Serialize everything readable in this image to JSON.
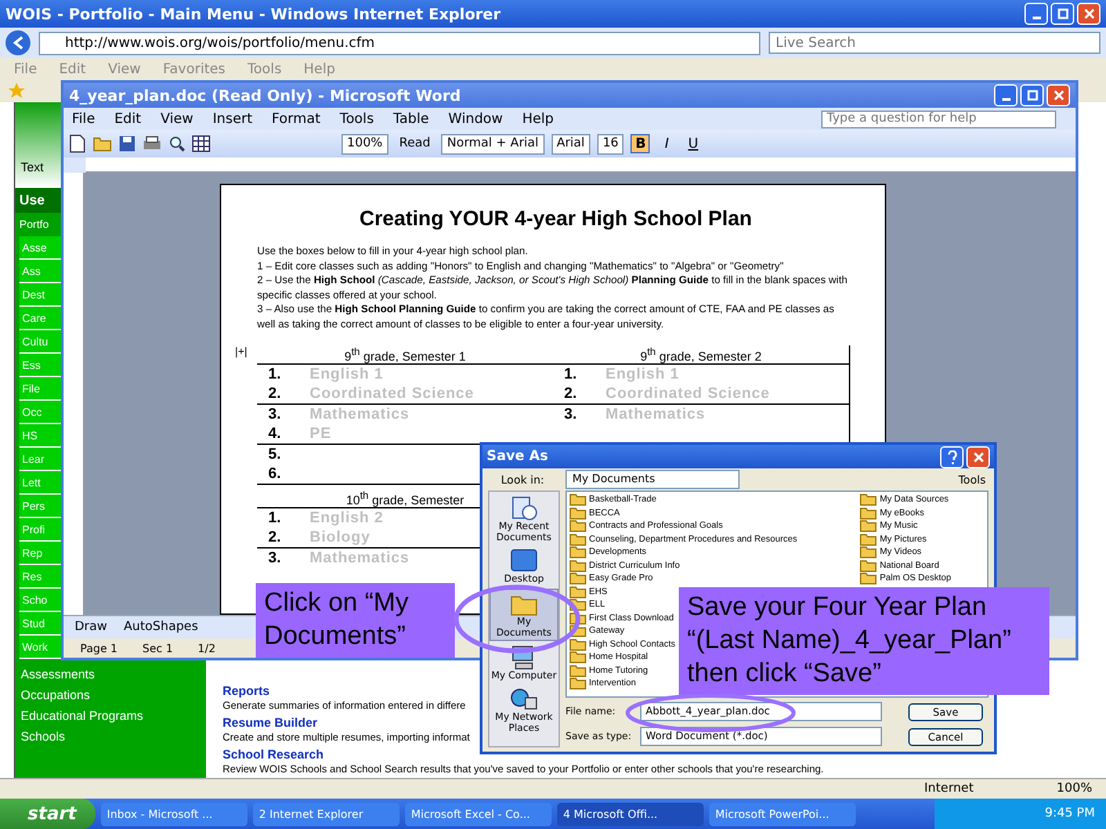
{
  "browser": {
    "title": "WOIS - Portfolio - Main Menu - Windows Internet Explorer",
    "address": "http://www.wois.org/wois/portfolio/menu.cfm",
    "search_placeholder": "Live Search",
    "menu": [
      "File",
      "Edit",
      "View",
      "Favorites",
      "Tools",
      "Help"
    ],
    "status": "Internet",
    "zoom": "100%"
  },
  "sidebar": {
    "header_text": "Text",
    "title": "Use",
    "section": "Portfo",
    "items": [
      "Asse",
      "Ass",
      "Dest",
      "Care",
      "Cultu",
      "Ess",
      "File",
      "Occ",
      "HS",
      "Lear",
      "Lett",
      "Pers",
      "Profi",
      "Rep",
      "Res",
      "Scho",
      "Stud",
      "Work"
    ],
    "links": [
      "Assessments",
      "Occupations",
      "Educational Programs",
      "Schools"
    ]
  },
  "content": [
    {
      "title": "Reports",
      "text": "Generate summaries of information entered in differe"
    },
    {
      "title": "Resume Builder",
      "text": "Create and store multiple resumes, importing informat"
    },
    {
      "title": "School Research",
      "text": "Review WOIS Schools and School Search results that you've saved to your Portfolio or enter other schools that you're researching."
    }
  ],
  "word": {
    "title": "4_year_plan.doc (Read Only) - Microsoft Word",
    "menu": [
      "File",
      "Edit",
      "View",
      "Insert",
      "Format",
      "Tools",
      "Table",
      "Window",
      "Help"
    ],
    "help_placeholder": "Type a question for help",
    "zoom": "100%",
    "read": "Read",
    "style": "Normal + Arial",
    "font": "Arial",
    "size": "16",
    "formatting": [
      {
        "label": "B",
        "on": true
      },
      {
        "label": "I",
        "on": false
      },
      {
        "label": "U",
        "on": false
      }
    ],
    "draw": "Draw",
    "autoshapes": "AutoShapes",
    "status": [
      "Page 1",
      "Sec 1",
      "1/2"
    ]
  },
  "document": {
    "heading": "Creating YOUR 4-year High School Plan",
    "paragraphs": [
      "Use the boxes below to fill in your 4-year high school plan.",
      "1 – Edit core classes such as adding \"Honors\" to English and changing \"Mathematics\" to \"Algebra\" or \"Geometry\"",
      "2 – Use the **High School** *(Cascade, Eastside, Jackson, or Scout's High School)* **Planning Guide** to fill in the blank spaces with specific classes offered at your school.",
      "3 – Also use the **High School Planning Guide** to confirm you are taking the correct amount of CTE, FAA and PE classes as well as taking the correct amount of classes to be eligible to enter a four-year university."
    ],
    "table_mark": "|+|",
    "semesters": [
      {
        "heading": "9$^{th}$ grade, Semester 1",
        "entries": [
          {
            "number": "1.",
            "course": "English 1"
          },
          {
            "number": "2.",
            "course": "Coordinated Science"
          },
          {
            "number": "3.",
            "course": "Mathematics"
          },
          {
            "number": "4.",
            "course": "PE"
          },
          {
            "number": "5."
          },
          {
            "number": "6."
          }
        ]
      },
      {
        "heading": "9$^{th}$ grade, Semester 2",
        "entries": [
          {
            "number": "1.",
            "course": "English 1"
          },
          {
            "number": "2.",
            "course": "Coordinated Science"
          },
          {
            "number": "3.",
            "course": "Mathematics"
          }
        ]
      },
      {
        "heading": "10$^{th}$ grade, Semester",
        "entries": [
          {
            "number": "1.",
            "course": "English 2"
          },
          {
            "number": "2.",
            "course": "Biology"
          },
          {
            "number": "3.",
            "course": "Mathematics"
          }
        ]
      }
    ]
  },
  "dialog": {
    "title": "Save As",
    "look_in_label": "Look in:",
    "look_in": "My Documents",
    "tools": "Tools",
    "places": [
      {
        "label": "My Recent Documents",
        "kind": "recent",
        "selected": false
      },
      {
        "label": "Desktop",
        "kind": "desktop",
        "selected": false
      },
      {
        "label": "My Documents",
        "kind": "documents",
        "selected": true
      },
      {
        "label": "My Computer",
        "kind": "computer",
        "selected": false
      },
      {
        "label": "My Network Places",
        "kind": "network",
        "selected": false
      }
    ],
    "folders": [
      "Basketball-Trade",
      "BECCA",
      "Contracts and Professional Goals",
      "Counseling, Department Procedures and Resources",
      "Developments",
      "District Curriculum Info",
      "Easy Grade Pro",
      "EHS",
      "ELL",
      "First Class Download",
      "Gateway",
      "High School Contacts",
      "Home Hospital",
      "Home Tutoring",
      "Intervention"
    ],
    "special_folders": [
      "My Data Sources",
      "My eBooks",
      "My Music",
      "My Pictures",
      "My Videos",
      "National Board",
      "Palm OS Desktop"
    ],
    "file_name_label": "File name:",
    "file_name": "Abbott_4_year_plan.doc",
    "type_label": "Save as type:",
    "type": "Word Document (*.doc)",
    "buttons": [
      "Save",
      "Cancel"
    ]
  },
  "callouts": [
    "Click on “My Documents”",
    "Save your Four Year Plan “(Last Name)_4_year_Plan” then click “Save”"
  ],
  "taskbar": {
    "start": "start",
    "buttons": [
      {
        "label": "Inbox - Microsoft ...",
        "selected": false
      },
      {
        "label": "2 Internet Explorer",
        "selected": false
      },
      {
        "label": "Microsoft Excel - Co...",
        "selected": false
      },
      {
        "label": "4 Microsoft Offi...",
        "selected": true
      },
      {
        "label": "Microsoft PowerPoi...",
        "selected": false
      }
    ],
    "clock": "9:45 PM"
  }
}
